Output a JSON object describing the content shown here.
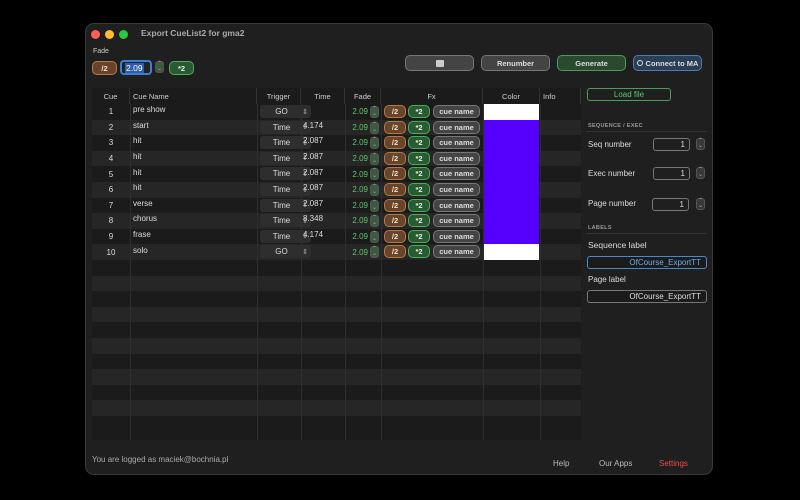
{
  "window": {
    "title": "Export CueList2 for gma2"
  },
  "fade": {
    "label": "Fade",
    "value": "2.09",
    "half": "/2",
    "double": "*2"
  },
  "toolbar": {
    "print_icon": "printer-icon",
    "renumber": "Renumber",
    "generate": "Generate",
    "connect": "Connect to MA"
  },
  "table": {
    "headers": [
      "Cue",
      "Cue Name",
      "Trigger",
      "Time",
      "Fade",
      "Fx",
      "Color",
      "Info"
    ],
    "fx": {
      "half": "/2",
      "double": "*2",
      "name": "cue name"
    },
    "rows": [
      {
        "cue": "1",
        "name": "pre show",
        "trigger": "GO",
        "time": "",
        "fade": "2.09",
        "color": "#ffffff"
      },
      {
        "cue": "2",
        "name": "start",
        "trigger": "Time",
        "time": "4.174",
        "fade": "2.09",
        "color": "#5500ff"
      },
      {
        "cue": "3",
        "name": "hit",
        "trigger": "Time",
        "time": "2.087",
        "fade": "2.09",
        "color": "#5500ff"
      },
      {
        "cue": "4",
        "name": "hit",
        "trigger": "Time",
        "time": "2.087",
        "fade": "2.09",
        "color": "#5500ff"
      },
      {
        "cue": "5",
        "name": "hit",
        "trigger": "Time",
        "time": "2.087",
        "fade": "2.09",
        "color": "#5500ff"
      },
      {
        "cue": "6",
        "name": "hit",
        "trigger": "Time",
        "time": "2.087",
        "fade": "2.09",
        "color": "#5500ff"
      },
      {
        "cue": "7",
        "name": "verse",
        "trigger": "Time",
        "time": "2.087",
        "fade": "2.09",
        "color": "#5500ff"
      },
      {
        "cue": "8",
        "name": "chorus",
        "trigger": "Time",
        "time": "8.348",
        "fade": "2.09",
        "color": "#5500ff"
      },
      {
        "cue": "9",
        "name": "frase",
        "trigger": "Time",
        "time": "4.174",
        "fade": "2.09",
        "color": "#5500ff"
      },
      {
        "cue": "10",
        "name": "solo",
        "trigger": "GO",
        "time": "",
        "fade": "2.09",
        "color": "#ffffff"
      }
    ]
  },
  "side": {
    "load_file": "Load file",
    "seq_section": "SEQUENCE / EXEC",
    "seq_label": "Seq number",
    "seq_value": "1",
    "exec_label": "Exec number",
    "exec_value": "1",
    "page_label": "Page number",
    "page_value": "1",
    "labels_section": "LABELS",
    "sequence_label": "Sequence label",
    "sequence_value": "OfCourse_ExportTT",
    "page_label_label": "Page label",
    "page_label_value": "OfCourse_ExportTT"
  },
  "footer": {
    "logged": "You are logged as maciek@bochnia.pl",
    "help": "Help",
    "apps": "Our Apps",
    "settings": "Settings"
  }
}
